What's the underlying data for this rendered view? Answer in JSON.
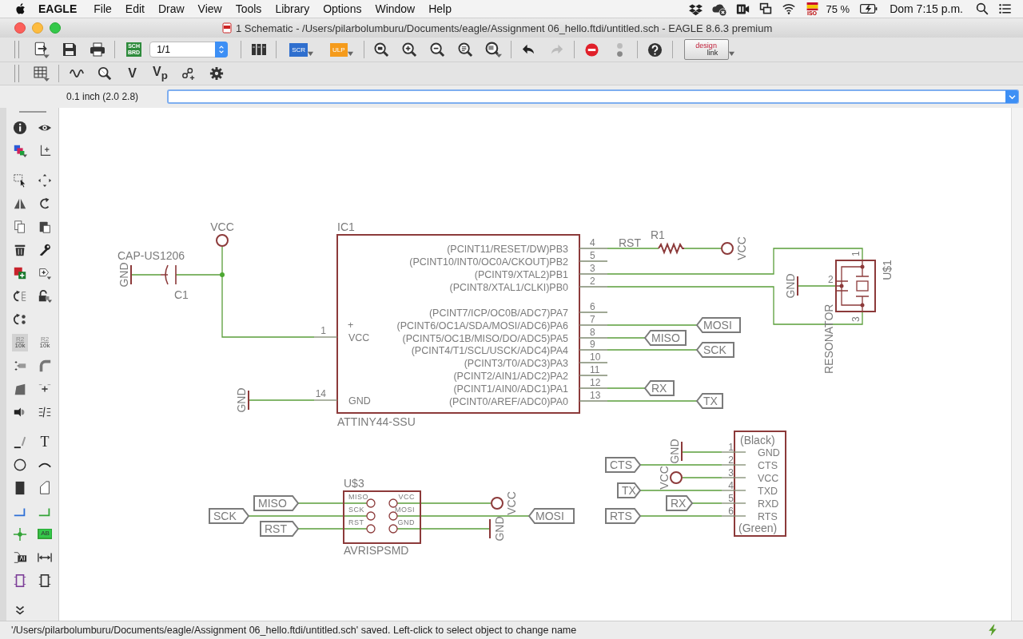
{
  "menubar": {
    "app": "EAGLE",
    "menus": [
      "File",
      "Edit",
      "Draw",
      "View",
      "Tools",
      "Library",
      "Options",
      "Window",
      "Help"
    ],
    "input_source": "ISO",
    "battery": "75 %",
    "clock": "Dom 7:15 p.m."
  },
  "window": {
    "title": "1 Schematic - /Users/pilarbolumburu/Documents/eagle/Assignment 06_hello.ftdi/untitled.sch - EAGLE 8.6.3 premium"
  },
  "toolbar": {
    "sch_brd": [
      "SCH",
      "BRD"
    ],
    "sheet": "1/1",
    "script": "SCR",
    "ulp": "ULP",
    "redo_disabled": true,
    "design_link": [
      "design",
      "link"
    ]
  },
  "toolbar2": {
    "value": "V",
    "value_pin": "V$_{p}$"
  },
  "coordinates": "0.1 inch (2.0 2.8)",
  "left_toolbar": [
    {
      "selected": false
    },
    {
      "selected": false
    },
    {
      "selected": false
    },
    {
      "selected": false
    },
    {
      "selected": false
    },
    {
      "selected": false
    },
    {
      "selected": false
    },
    {
      "selected": false
    },
    {
      "selected": false
    },
    {
      "selected": false
    },
    {
      "selected": false
    },
    {
      "selected": false
    },
    {
      "selected": false
    },
    {
      "selected": false
    },
    {
      "selected": false
    },
    {
      "selected": false
    },
    {
      "selected": false
    },
    {
      "selected": true,
      "label": "R2",
      "sublabel": "10k"
    },
    {
      "selected": false,
      "label": "R2",
      "sublabel": "10k"
    },
    {
      "selected": false
    },
    {
      "selected": false
    },
    {
      "selected": false
    },
    {
      "selected": false
    },
    {
      "selected": false
    },
    {
      "selected": false
    },
    {
      "selected": false
    },
    {
      "selected": false,
      "label": "T"
    },
    {
      "selected": false
    },
    {
      "selected": false
    },
    {
      "selected": false
    },
    {
      "selected": false
    },
    {
      "selected": false
    },
    {
      "selected": false
    },
    {
      "selected": false
    },
    {
      "selected": false,
      "label": "AB"
    },
    {
      "selected": false
    },
    {
      "selected": false
    },
    {
      "selected": false
    },
    {
      "selected": false
    },
    {
      "selected": false
    }
  ],
  "schematic": {
    "capacitor": {
      "name": "C1",
      "value": "CAP-US1206"
    },
    "supplies": [
      {
        "kind": "vcc",
        "label": "VCC"
      },
      {
        "kind": "gnd",
        "label": "GND"
      },
      {
        "kind": "gnd",
        "label": "GND"
      },
      {
        "kind": "vcc",
        "label": "VCC"
      },
      {
        "kind": "gnd",
        "label": "GND"
      },
      {
        "kind": "gnd",
        "label": "GND"
      },
      {
        "kind": "vcc",
        "label": "VCC"
      },
      {
        "kind": "vcc",
        "label": "VCC"
      },
      {
        "kind": "gnd",
        "label": "GND"
      }
    ],
    "ic": {
      "name": "IC1",
      "value": "ATTINY44-SSU",
      "polarity": "+",
      "left_pins": [
        {
          "number": "1",
          "label": "VCC"
        },
        {
          "number": "14",
          "label": "GND"
        }
      ],
      "right_pins": [
        {
          "number": "4",
          "label": "(PCINT11/RESET/DW)PB3"
        },
        {
          "number": "5",
          "label": "(PCINT10/INT0/OC0A/CKOUT)PB2"
        },
        {
          "number": "3",
          "label": "(PCINT9/XTAL2)PB1"
        },
        {
          "number": "2",
          "label": "(PCINT8/XTAL1/CLKI)PB0"
        },
        {
          "number": "6",
          "label": "(PCINT7/ICP/OC0B/ADC7)PA7"
        },
        {
          "number": "7",
          "label": "(PCINT6/OC1A/SDA/MOSI/ADC6)PA6"
        },
        {
          "number": "8",
          "label": "(PCINT5/OC1B/MISO/DO/ADC5)PA5"
        },
        {
          "number": "9",
          "label": "(PCINT4/T1/SCL/USCK/ADC4)PA4"
        },
        {
          "number": "10",
          "label": "(PCINT3/T0/ADC3)PA3"
        },
        {
          "number": "11",
          "label": "(PCINT2/AIN1/ADC2)PA2"
        },
        {
          "number": "12",
          "label": "(PCINT1/AIN0/ADC1)PA1"
        },
        {
          "number": "13",
          "label": "(PCINT0/AREF/ADC0)PA0"
        }
      ]
    },
    "resistor": {
      "name": "R1"
    },
    "resonator": {
      "name": "U$1",
      "value": "RESONATOR",
      "pins": [
        "1",
        "2",
        "3"
      ]
    },
    "net_labels": [
      {
        "kind": "text",
        "text": "RST"
      },
      {
        "kind": "flag",
        "text": "MOSI"
      },
      {
        "kind": "flag",
        "text": "MISO"
      },
      {
        "kind": "flag",
        "text": "SCK"
      },
      {
        "kind": "flag",
        "text": "RX"
      },
      {
        "kind": "flag",
        "text": "TX"
      },
      {
        "kind": "flag",
        "text": "CTS"
      },
      {
        "kind": "flag",
        "text": "TX"
      },
      {
        "kind": "flag",
        "text": "RX"
      },
      {
        "kind": "flag",
        "text": "RTS"
      },
      {
        "kind": "flag",
        "text": "MISO"
      },
      {
        "kind": "flag",
        "text": "SCK"
      },
      {
        "kind": "flag",
        "text": "RST"
      },
      {
        "kind": "flag",
        "text": "MOSI"
      }
    ],
    "isp": {
      "name": "U$3",
      "value": "AVRISPSMD",
      "pins": [
        "MISO",
        "VCC",
        "SCK",
        "MOSI",
        "RST",
        "GND"
      ]
    },
    "connector": {
      "header": "(Black)",
      "footer": "(Green)",
      "pins": [
        {
          "number": "1",
          "label": "GND"
        },
        {
          "number": "2",
          "label": "CTS"
        },
        {
          "number": "3",
          "label": "VCC"
        },
        {
          "number": "4",
          "label": "TXD"
        },
        {
          "number": "5",
          "label": "RXD"
        },
        {
          "number": "6",
          "label": "RTS"
        }
      ]
    }
  },
  "status_bar": {
    "message": "'/Users/pilarbolumburu/Documents/eagle/Assignment 06_hello.ftdi/untitled.sch' saved. Left-click to select object to change name"
  }
}
